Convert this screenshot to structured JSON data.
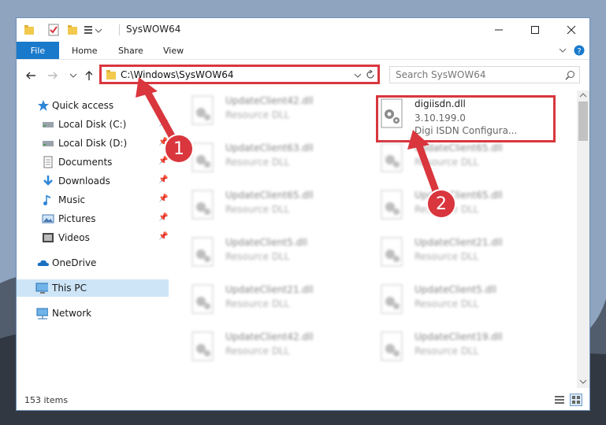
{
  "window": {
    "title": "SysWOW64",
    "minimize_icon": "minimize-icon",
    "maximize_icon": "maximize-icon",
    "close_icon": "close-icon"
  },
  "ribbon": {
    "tabs": [
      {
        "label": "File"
      },
      {
        "label": "Home"
      },
      {
        "label": "Share"
      },
      {
        "label": "View"
      }
    ]
  },
  "address": {
    "path": "C:\\Windows\\SysWOW64",
    "search_placeholder": "Search SysWOW64"
  },
  "nav": {
    "items": [
      {
        "label": "Quick access",
        "icon": "star-icon"
      },
      {
        "label": "Local Disk (C:)",
        "icon": "drive-icon"
      },
      {
        "label": "Local Disk (D:)",
        "icon": "drive-icon"
      },
      {
        "label": "Documents",
        "icon": "documents-icon"
      },
      {
        "label": "Downloads",
        "icon": "download-icon"
      },
      {
        "label": "Music",
        "icon": "music-icon"
      },
      {
        "label": "Pictures",
        "icon": "pictures-icon"
      },
      {
        "label": "Videos",
        "icon": "videos-icon"
      },
      {
        "label": "OneDrive",
        "icon": "cloud-icon"
      },
      {
        "label": "This PC",
        "icon": "computer-icon"
      },
      {
        "label": "Network",
        "icon": "network-icon"
      }
    ]
  },
  "files": {
    "highlighted": {
      "name": "digiisdn.dll",
      "version": "3.10.199.0",
      "description": "Digi ISDN Configura..."
    },
    "left_column": [
      {
        "name": "UpdateClient42.dll",
        "desc": "Resource DLL"
      },
      {
        "name": "UpdateClient63.dll",
        "desc": "Resource DLL"
      },
      {
        "name": "UpdateClient65.dll",
        "desc": "Resource DLL"
      },
      {
        "name": "UpdateClient5.dll",
        "desc": "Resource DLL"
      },
      {
        "name": "UpdateClient21.dll",
        "desc": "Resource DLL"
      },
      {
        "name": "UpdateClient42.dll",
        "desc": "Resource DLL"
      }
    ],
    "right_column": [
      {
        "name": "UpdateClient65.dll",
        "desc": "Resource DLL"
      },
      {
        "name": "UpdateClient65.dll",
        "desc": "Resource DLL"
      },
      {
        "name": "UpdateClient21.dll",
        "desc": "Resource DLL"
      },
      {
        "name": "UpdateClient5.dll",
        "desc": "Resource DLL"
      },
      {
        "name": "UpdateClient19.dll",
        "desc": "Resource DLL"
      }
    ]
  },
  "status": {
    "item_count": "153 items"
  },
  "annotations": {
    "step1": "1",
    "step2": "2",
    "color": "#d9363e"
  }
}
